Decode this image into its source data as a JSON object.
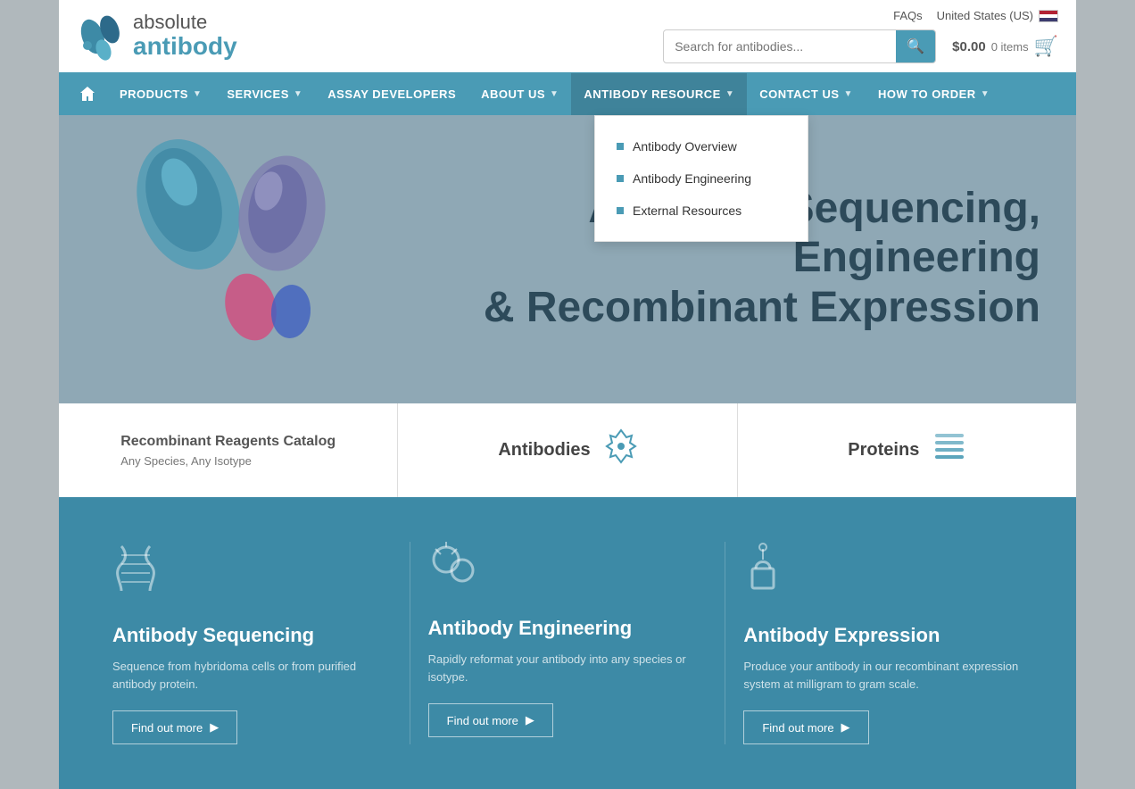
{
  "topbar": {
    "logo": {
      "absolute": "absolute",
      "antibody": "antibody"
    },
    "meta": {
      "faqs": "FAQs",
      "country": "United States (US)"
    },
    "search": {
      "placeholder": "Search for antibodies...",
      "value": ""
    },
    "cart": {
      "price": "$0.00",
      "items": "0 items"
    }
  },
  "nav": {
    "home_title": "Home",
    "items": [
      {
        "label": "PRODUCTS",
        "has_dropdown": true
      },
      {
        "label": "SERVICES",
        "has_dropdown": true
      },
      {
        "label": "ASSAY DEVELOPERS",
        "has_dropdown": false
      },
      {
        "label": "ABOUT US",
        "has_dropdown": true
      },
      {
        "label": "ANTIBODY RESOURCE",
        "has_dropdown": true,
        "active": true
      },
      {
        "label": "CONTACT US",
        "has_dropdown": true
      },
      {
        "label": "HOW TO ORDER",
        "has_dropdown": true
      }
    ],
    "dropdown": {
      "title": "ANTIBODY RESOURCE",
      "items": [
        {
          "label": "Antibody Overview"
        },
        {
          "label": "Antibody Engineering"
        },
        {
          "label": "External Resources"
        }
      ]
    }
  },
  "hero": {
    "title_line1": "Antibody Sequencing, Engineering",
    "title_line2": "& Recombinant Expression"
  },
  "product_tiles": [
    {
      "title": "Recombinant Reagents Catalog",
      "subtitle": "Any Species, Any Isotype",
      "icon": "🧬"
    },
    {
      "title": "Antibodies",
      "icon": "⚡"
    },
    {
      "title": "Proteins",
      "icon": "≡"
    }
  ],
  "services": [
    {
      "icon": "🧬",
      "title": "Antibody Sequencing",
      "desc": "Sequence from hybridoma cells or from purified antibody protein.",
      "btn_label": "Find out more"
    },
    {
      "icon": "⚙",
      "title": "Antibody Engineering",
      "desc": "Rapidly reformat your antibody into any species or isotype.",
      "btn_label": "Find out more"
    },
    {
      "icon": "🧪",
      "title": "Antibody Expression",
      "desc": "Produce your antibody in our recombinant expression system at milligram to gram scale.",
      "btn_label": "Find out more"
    }
  ]
}
